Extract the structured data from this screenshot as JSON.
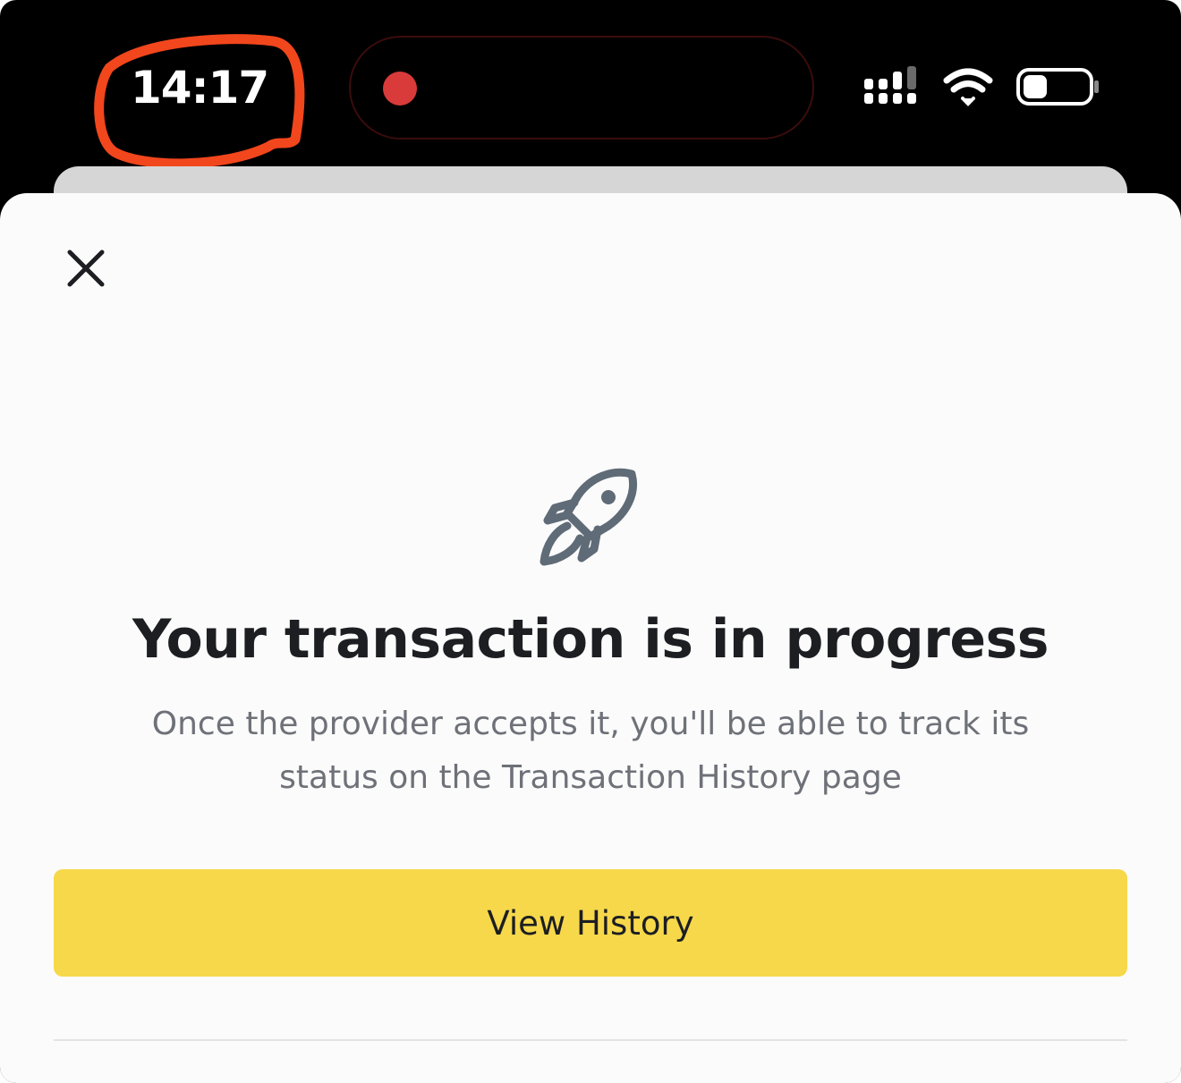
{
  "status_bar": {
    "time": "14:17",
    "recording_indicator_color": "#d93a3a",
    "annotation_color": "#f2461c",
    "icons": [
      "cellular-signal-icon",
      "wifi-icon",
      "battery-icon"
    ]
  },
  "sheet": {
    "close_icon": "close-icon",
    "hero_icon": "rocket-icon",
    "title": "Your transaction is in progress",
    "subtitle": "Once the provider accepts it, you'll be able to track its status on the Transaction History page",
    "primary_button_label": "View History",
    "accent_color": "#f6d84a"
  }
}
